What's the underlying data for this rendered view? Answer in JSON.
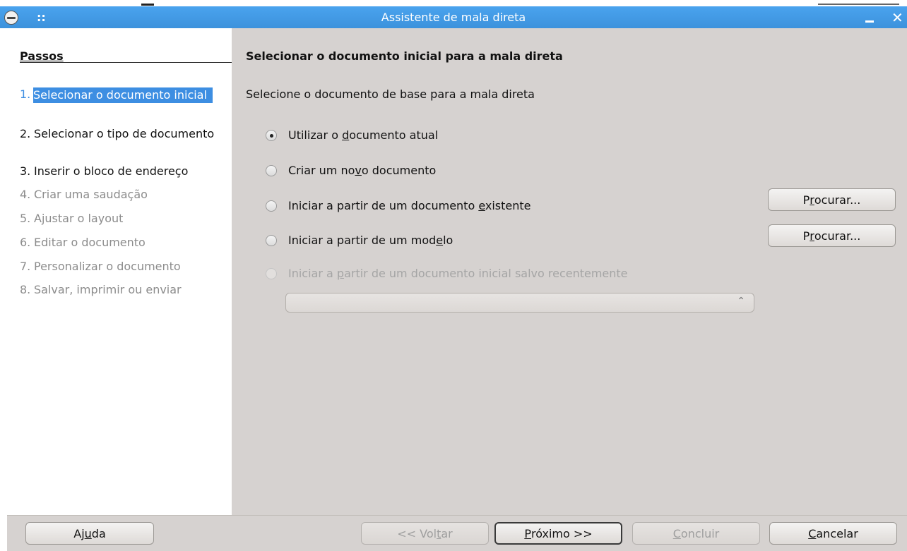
{
  "window": {
    "title": "Assistente de mala direta",
    "menu_glyph": "::",
    "minimize_glyph": "_",
    "close_glyph": "✕"
  },
  "steps": {
    "heading": "Passos",
    "items": [
      {
        "num": "1.",
        "label": "Selecionar o documento inicial",
        "state": "active"
      },
      {
        "num": "2.",
        "label": "Selecionar o tipo de documento",
        "state": "enabled"
      },
      {
        "num": "3.",
        "label": "Inserir o bloco de endereço",
        "state": "enabled"
      },
      {
        "num": "4.",
        "label": "Criar uma saudação",
        "state": "disabled"
      },
      {
        "num": "5.",
        "label": "Ajustar o layout",
        "state": "disabled"
      },
      {
        "num": "6.",
        "label": "Editar o documento",
        "state": "disabled"
      },
      {
        "num": "7.",
        "label": "Personalizar o documento",
        "state": "disabled"
      },
      {
        "num": "8.",
        "label": "Salvar, imprimir ou enviar",
        "state": "disabled"
      }
    ]
  },
  "main": {
    "title": "Selecionar o documento inicial para a mala direta",
    "subtitle": "Selecione o documento de base para a mala direta",
    "options": [
      {
        "pre": "Utilizar o ",
        "key": "d",
        "post": "ocumento atual",
        "checked": true,
        "enabled": true
      },
      {
        "pre": "Criar um no",
        "key": "v",
        "post": "o documento",
        "checked": false,
        "enabled": true
      },
      {
        "pre": "Iniciar a partir de um documento ",
        "key": "e",
        "post": "xistente",
        "checked": false,
        "enabled": true
      },
      {
        "pre": "Iniciar a partir de um mod",
        "key": "e",
        "post": "lo",
        "checked": false,
        "enabled": true
      },
      {
        "pre": "Iniciar a ",
        "key": "p",
        "post": "artir de um documento inicial salvo recentemente",
        "checked": false,
        "enabled": false
      }
    ],
    "browse_button": {
      "pre": "P",
      "key": "r",
      "post": "ocurar..."
    },
    "recent_combo_value": "",
    "combo_arrow": "⌃⌄"
  },
  "footer": {
    "help": {
      "pre": "Aj",
      "key": "u",
      "post": "da"
    },
    "back": {
      "pre": "<< Vol",
      "key": "t",
      "post": "ar"
    },
    "next": {
      "pre": "",
      "key": "P",
      "post": "róximo >>"
    },
    "finish": {
      "pre": "",
      "key": "C",
      "post": "oncluir"
    },
    "cancel": {
      "pre": "",
      "key": "C",
      "post": "ancelar"
    }
  },
  "colors": {
    "titlebar": "#3c92dc",
    "selection": "#3d8ee2",
    "dialog_bg": "#d6d2d0"
  }
}
